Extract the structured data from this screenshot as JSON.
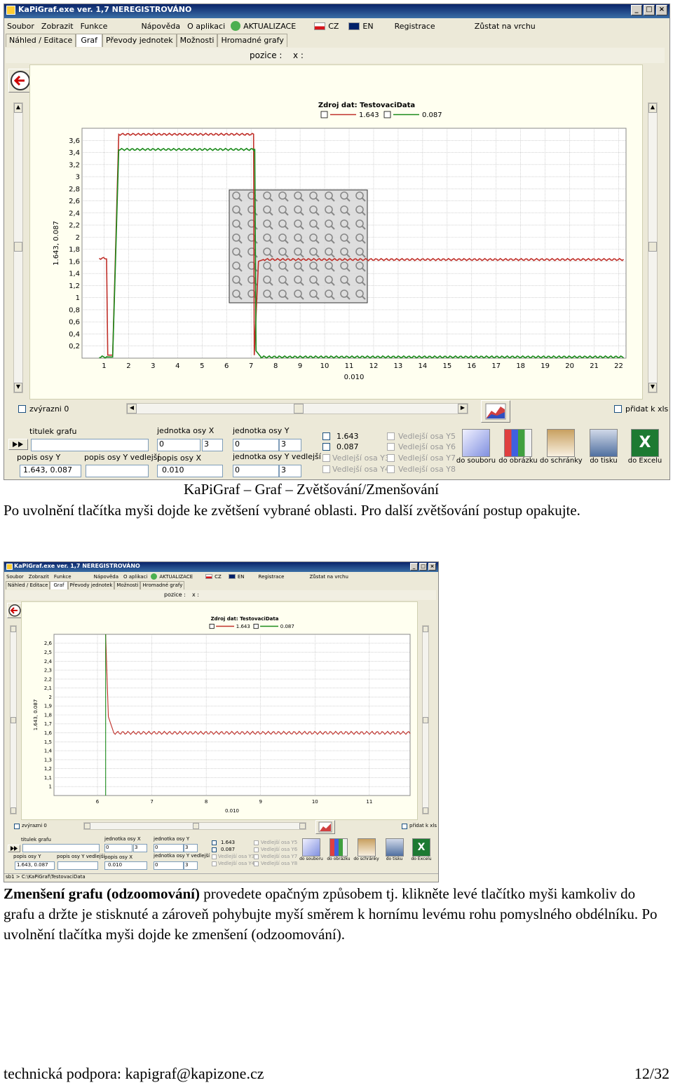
{
  "app": {
    "title": "KaPiGraf.exe  ver. 1,7   NEREGISTROVÁNO",
    "window_buttons": [
      "_",
      "□",
      "×"
    ],
    "menu": [
      "Soubor",
      "Zobrazit",
      "Funkce",
      "Nápověda",
      "O aplikaci",
      "AKTUALIZACE",
      "CZ",
      "EN",
      "Registrace",
      "Zůstat na vrchu"
    ],
    "tabs": [
      "Náhled / Editace",
      "Graf",
      "Převody jednotek",
      "Možnosti",
      "Hromadné grafy"
    ],
    "active_tab": "Graf",
    "position_label": "pozice :",
    "position_x_label": "x :",
    "legend": {
      "title": "Zdroj dat: TestovaciData",
      "series1_value": "1.643",
      "series2_value": "0.087"
    },
    "zoom_checkbox": "zvýrazni 0",
    "add_xls_checkbox": "přidat k xls",
    "fields": {
      "title_label": "titulek grafu",
      "title_value": "",
      "unit_x_label": "jednotka osy X",
      "unit_x_value": "0",
      "unit_x_dec": "3",
      "unit_y_label": "jednotka osy Y",
      "unit_y_value": "0",
      "unit_y_dec": "3",
      "desc_y_label": "popis osy Y",
      "desc_y_value": "1.643,  0.087",
      "desc_y2_label": "popis osy Y vedlejší",
      "desc_y2_value": "",
      "desc_x_label": "popis osy X",
      "desc_x_value": "0.010",
      "unit_y2_label": "jednotka osy Y vedlejší",
      "unit_y2_value": "0",
      "unit_y2_dec": "3"
    },
    "series_checks": [
      "1.643",
      "0.087",
      "Vedlejší osa Y3",
      "Vedlejší osa Y4"
    ],
    "aux_checks": [
      "Vedlejší osa Y5",
      "Vedlejší osa Y6",
      "Vedlejší osa Y7",
      "Vedlejší osa Y8"
    ],
    "export_buttons": [
      "do souboru",
      "do obrázku",
      "do schránky",
      "do tisku",
      "do Excelu"
    ],
    "status": "sb1 > C:\\KaPiGraf\\TestovaciData"
  },
  "chart_data": [
    {
      "type": "line",
      "ylabel": "1.643,  0.087",
      "xlabel": "0.010",
      "x_ticks": [
        1,
        2,
        3,
        4,
        5,
        6,
        7,
        8,
        9,
        10,
        11,
        12,
        13,
        14,
        15,
        16,
        17,
        18,
        19,
        20,
        21,
        22
      ],
      "y_ticks": [
        "0,2",
        "0,4",
        "0,6",
        "0,8",
        "1",
        "1,2",
        "1,4",
        "1,6",
        "1,8",
        "2",
        "2,2",
        "2,4",
        "2,6",
        "2,8",
        "3",
        "3,2",
        "3,4",
        "3,6"
      ],
      "xlim": [
        0.1,
        22.3
      ],
      "ylim": [
        0,
        3.8
      ],
      "grid": true,
      "legend": "top-center",
      "series": [
        {
          "name": "1.643",
          "color": "#c0302a",
          "x": [
            0.8,
            1.1,
            1.15,
            1.35,
            1.6,
            7.1,
            7.13,
            7.3,
            7.5,
            22.2
          ],
          "y": [
            1.65,
            1.65,
            0.05,
            0.05,
            3.7,
            3.7,
            0.05,
            1.6,
            1.63,
            1.63
          ]
        },
        {
          "name": "0.087",
          "color": "#1a8a1a",
          "x": [
            0.8,
            1.1,
            1.15,
            1.35,
            1.6,
            7.1,
            7.15,
            7.2,
            7.4,
            22.2
          ],
          "y": [
            0.02,
            0.02,
            0.02,
            0.02,
            3.45,
            3.45,
            3.45,
            0.12,
            0.02,
            0.02
          ]
        }
      ],
      "zoom_selection": "rectangle with magnifier pattern"
    },
    {
      "type": "line",
      "ylabel": "1.643,  0.087",
      "xlabel": "0.010",
      "x_ticks": [
        6,
        7,
        8,
        9,
        10,
        11
      ],
      "y_ticks": [
        "1",
        "1,1",
        "1,2",
        "1,3",
        "1,4",
        "1,5",
        "1,6",
        "1,7",
        "1,8",
        "1,9",
        "2",
        "2,1",
        "2,2",
        "2,3",
        "2,4",
        "2,5",
        "2,6"
      ],
      "xlim": [
        5.2,
        11.75
      ],
      "ylim": [
        0.9,
        2.7
      ],
      "grid": true,
      "legend": "top-center",
      "series": [
        {
          "name": "1.643",
          "color": "#c0302a",
          "x": [
            6.15,
            6.2,
            6.3,
            11.75
          ],
          "y": [
            2.7,
            1.78,
            1.6,
            1.6
          ]
        },
        {
          "name": "0.087",
          "color": "#1a8a1a",
          "x": [
            6.15,
            6.15
          ],
          "y": [
            0.9,
            2.7
          ]
        }
      ]
    }
  ],
  "doc": {
    "caption": "KaPiGraf – Graf – Zvětšování/Zmenšování",
    "para1": "Po uvolnění tlačítka myši dojde ke zvětšení vybrané oblasti. Pro další zvětšování postup opakujte.",
    "para2_bold": "Zmenšení grafu (odzoomování)",
    "para2_rest": " provedete opačným způsobem tj. klikněte levé tlačítko myši kamkoliv do grafu a držte je stisknuté a zároveň pohybujte myší směrem k hornímu levému rohu pomyslného obdélníku. Po uvolnění tlačítka myši dojde ke zmenšení (odzoomování).",
    "footer_left": "technická podpora: kapigraf@kapizone.cz",
    "footer_right": "12/32"
  }
}
